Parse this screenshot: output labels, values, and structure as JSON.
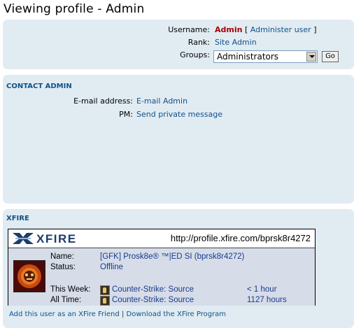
{
  "page": {
    "title": "Viewing profile - Admin"
  },
  "profile": {
    "username_label": "Username:",
    "username": "Admin",
    "administer_open": "[",
    "administer_link": "Administer user",
    "administer_close": "]",
    "rank_label": "Rank:",
    "rank": "Site Admin",
    "groups_label": "Groups:",
    "groups_selected": "Administrators",
    "go_label": "Go"
  },
  "contact": {
    "heading": "CONTACT ADMIN",
    "email_label": "E-mail address:",
    "email_link": "E-mail Admin",
    "pm_label": "PM:",
    "pm_link": "Send private message"
  },
  "xfire": {
    "heading": "XFIRE",
    "logo_text": "XFIRE",
    "url": "http://profile.xfire.com/bprsk8r4272",
    "name_label": "Name:",
    "name": "[GFK] Prosk8e® ™|ED SI (bprsk8r4272)",
    "status_label": "Status:",
    "status": "Offline",
    "this_week_label": "This Week:",
    "this_week_game": "Counter-Strike: Source",
    "this_week_time": "< 1 hour",
    "all_time_label": "All Time:",
    "all_time_game": "Counter-Strike: Source",
    "all_time_time": "1127 hours",
    "add_friend_link": "Add this user as an XFire Friend",
    "separator": "|",
    "download_link": "Download the XFire Program"
  },
  "colors": {
    "panel_bg": "#e1ebf2",
    "link": "#105289",
    "admin_name": "#aa0000"
  }
}
